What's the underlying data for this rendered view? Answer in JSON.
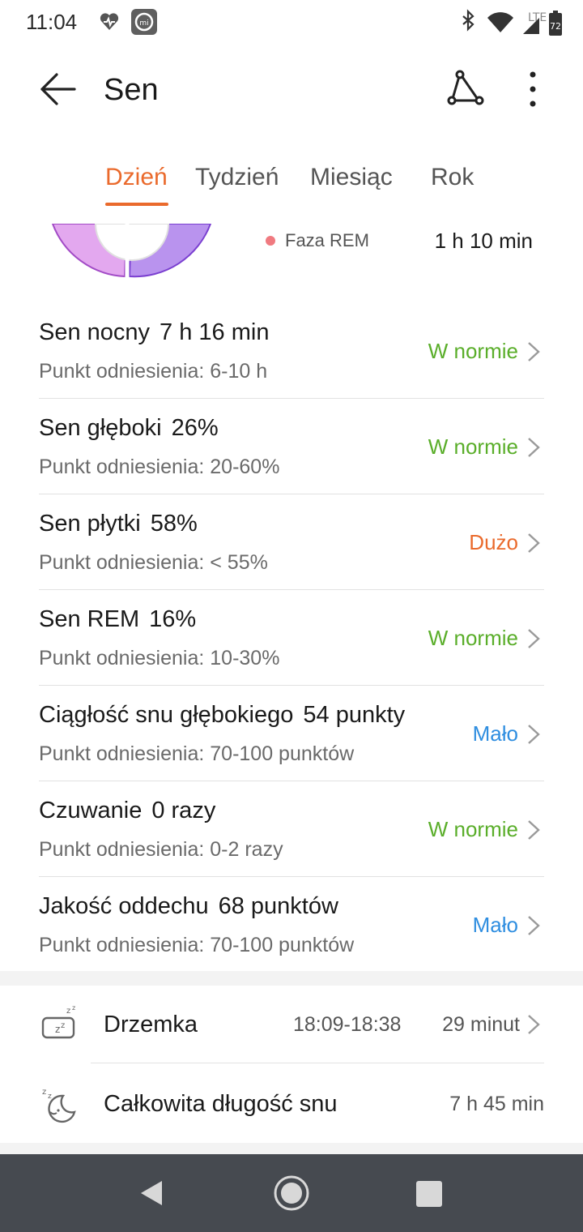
{
  "status_bar": {
    "time": "11:04",
    "network": "LTE",
    "battery": "72"
  },
  "app_bar": {
    "title": "Sen"
  },
  "tabs": [
    {
      "label": "Dzień",
      "active": true
    },
    {
      "label": "Tydzień",
      "active": false
    },
    {
      "label": "Miesiąc",
      "active": false
    },
    {
      "label": "Rok",
      "active": false
    }
  ],
  "legend": {
    "label": "Faza REM",
    "value": "1 h 10 min",
    "color": "#f07a80"
  },
  "metrics": [
    {
      "name": "Sen nocny",
      "value": "7 h 16 min",
      "reference": "Punkt odniesienia: 6-10 h",
      "status": "W normie",
      "status_color": "#5aae2a"
    },
    {
      "name": "Sen głęboki",
      "value": "26%",
      "reference": "Punkt odniesienia: 20-60%",
      "status": "W normie",
      "status_color": "#5aae2a"
    },
    {
      "name": "Sen płytki",
      "value": "58%",
      "reference": "Punkt odniesienia: < 55%",
      "status": "Dużo",
      "status_color": "#ea6a2c"
    },
    {
      "name": "Sen REM",
      "value": "16%",
      "reference": "Punkt odniesienia: 10-30%",
      "status": "W normie",
      "status_color": "#5aae2a"
    },
    {
      "name": "Ciągłość snu głębokiego",
      "value": "54 punkty",
      "reference": "Punkt odniesienia: 70-100 punktów",
      "status": "Mało",
      "status_color": "#2f8ee0"
    },
    {
      "name": "Czuwanie",
      "value": "0 razy",
      "reference": "Punkt odniesienia: 0-2 razy",
      "status": "W normie",
      "status_color": "#5aae2a"
    },
    {
      "name": "Jakość oddechu",
      "value": "68 punktów",
      "reference": "Punkt odniesienia: 70-100 punktów",
      "status": "Mało",
      "status_color": "#2f8ee0"
    }
  ],
  "nap": {
    "icon": "nap-icon",
    "label": "Drzemka",
    "time_range": "18:09-18:38",
    "duration": "29 minut"
  },
  "total": {
    "icon": "moon-sleep-icon",
    "label": "Całkowita długość snu",
    "duration": "7 h 45 min"
  },
  "colors": {
    "accent": "#ea6a2c",
    "normal": "#5aae2a",
    "low": "#2f8ee0"
  }
}
